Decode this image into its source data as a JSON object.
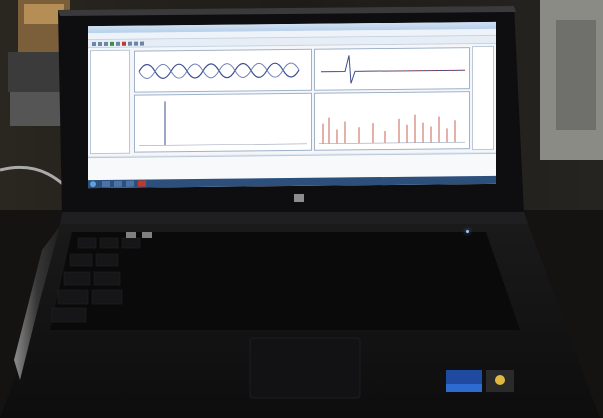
{
  "scene": {
    "subject": "laptop-on-desk",
    "colors": {
      "background": "#1b1a17",
      "laptop_body": "#111112",
      "screen_ui": "#dfe7f0",
      "plot_wave": "#3b4f8f",
      "plot_red": "#c0392b",
      "taskbar": "#2c4f7c"
    }
  },
  "screen": {
    "icons": [
      "start-orb-icon",
      "toolbar-icons"
    ]
  }
}
